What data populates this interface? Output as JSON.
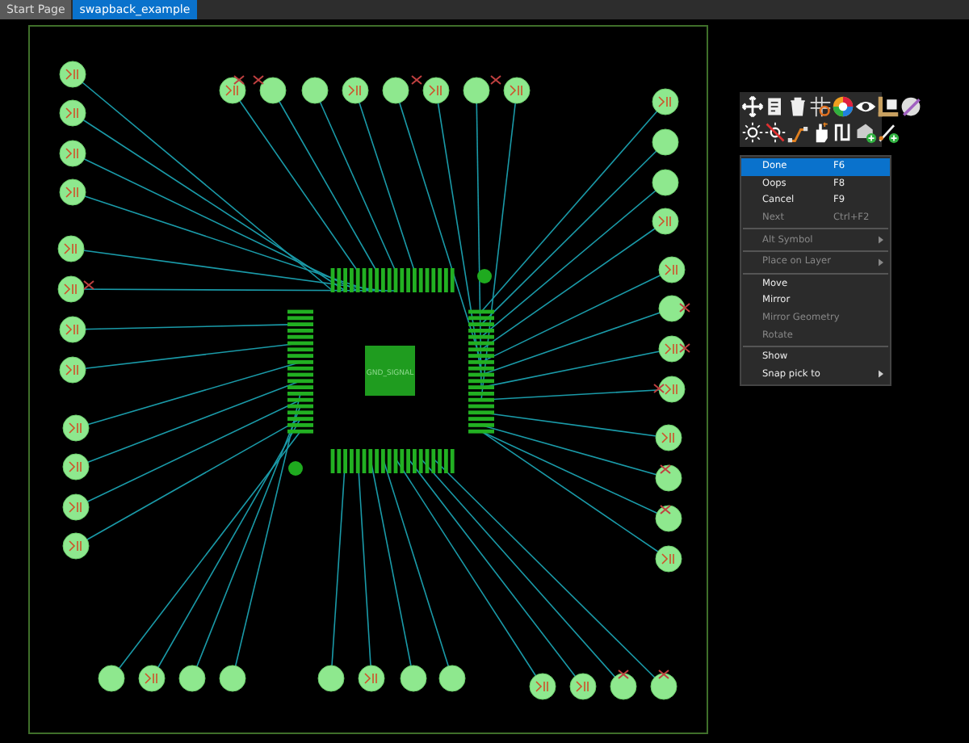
{
  "tabs": [
    {
      "label": "Start Page",
      "selected": false
    },
    {
      "label": "swapback_example",
      "selected": true
    }
  ],
  "board": {
    "component_label": "GND_SIGNAL"
  },
  "context_menu": {
    "groups": [
      [
        {
          "label": "Done",
          "shortcut": "F6",
          "selected": true,
          "disabled": false,
          "submenu": false
        },
        {
          "label": "Oops",
          "shortcut": "F8",
          "selected": false,
          "disabled": false,
          "submenu": false
        },
        {
          "label": "Cancel",
          "shortcut": "F9",
          "selected": false,
          "disabled": false,
          "submenu": false
        },
        {
          "label": "Next",
          "shortcut": "Ctrl+F2",
          "selected": false,
          "disabled": true,
          "submenu": false
        }
      ],
      [
        {
          "label": "Alt Symbol",
          "selected": false,
          "disabled": true,
          "submenu": true
        }
      ],
      [
        {
          "label": "Place on Layer",
          "selected": false,
          "disabled": true,
          "submenu": true
        }
      ],
      [
        {
          "label": "Move",
          "selected": false,
          "disabled": false,
          "submenu": false
        },
        {
          "label": "Mirror",
          "selected": false,
          "disabled": false,
          "submenu": false
        },
        {
          "label": "Mirror Geometry",
          "selected": false,
          "disabled": true,
          "submenu": false
        },
        {
          "label": "Rotate",
          "selected": false,
          "disabled": true,
          "submenu": false
        }
      ],
      [
        {
          "label": "Show",
          "selected": false,
          "disabled": false,
          "submenu": false
        },
        {
          "label": "Snap pick to",
          "selected": false,
          "disabled": false,
          "submenu": true
        }
      ]
    ]
  }
}
